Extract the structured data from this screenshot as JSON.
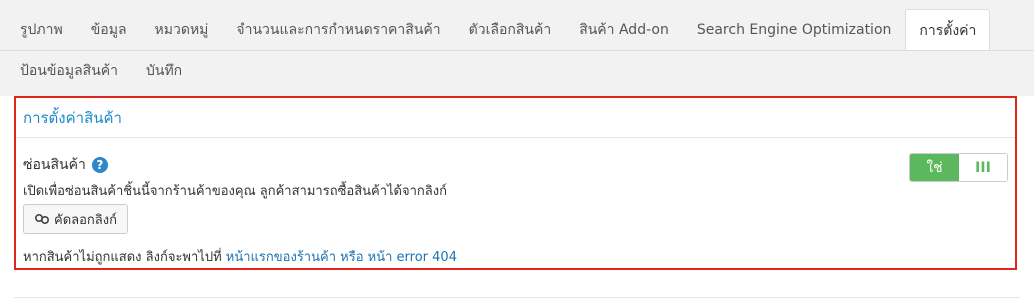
{
  "tabs": {
    "row1": [
      "รูปภาพ",
      "ข้อมูล",
      "หมวดหมู่",
      "จำนวนและการกำหนดราคาสินค้า",
      "ตัวเลือกสินค้า",
      "สินค้า Add-on",
      "Search Engine Optimization",
      "การตั้งค่า"
    ],
    "row2": [
      "ป้อนข้อมูลสินค้า",
      "บันทึก"
    ],
    "active": "การตั้งค่า"
  },
  "panel": {
    "title": "การตั้งค่าสินค้า",
    "field_label": "ซ่อนสินค้า",
    "help_icon": "?",
    "description": "เปิดเพื่อซ่อนสินค้าชิ้นนี้จากร้านค้าของคุณ ลูกค้าสามารถซื้อสินค้าได้จากลิงก์",
    "copy_button": "คัดลอกลิงก์",
    "hint_prefix": "หากสินค้าไม่ถูกแสดง ลิงก์จะพาไปที่",
    "hint_link1": "หน้าแรกของร้านค้า",
    "hint_or": "หรือ",
    "hint_link2": "หน้า",
    "hint_error": "error 404",
    "toggle_on": "ใช่",
    "toggle_off": "III"
  },
  "colors": {
    "accent": "#1a8acb",
    "highlight_border": "#e0261b",
    "toggle_green": "#5cb85c"
  }
}
